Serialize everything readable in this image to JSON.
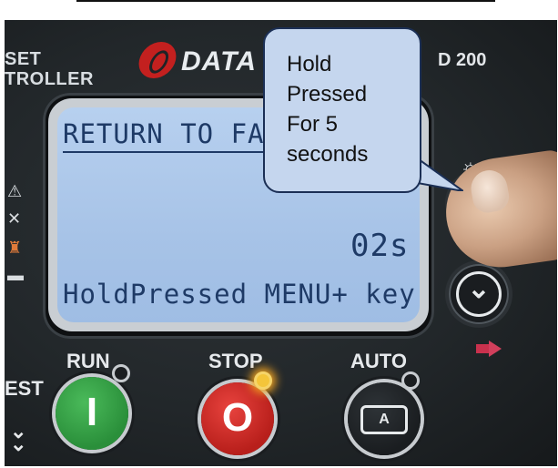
{
  "panel": {
    "left_legend": [
      "SET",
      "TROLLER"
    ],
    "brand": "DATA",
    "model": "D 200"
  },
  "lcd": {
    "line1": "RETURN TO FA",
    "countdown": "02s",
    "line3": "HoldPressed MENU+ key"
  },
  "callout": {
    "lines": [
      "Hold",
      "Pressed",
      "For 5",
      "seconds"
    ]
  },
  "buttons": {
    "run_label": "RUN",
    "stop_label": "STOP",
    "auto_label": "AUTO",
    "test_label": "EST",
    "run_glyph": "I",
    "stop_glyph": "O",
    "auto_glyph": "A"
  },
  "icons": {
    "warning": "warning-icon",
    "tools": "wrench-icon",
    "generator": "tower-icon",
    "battery": "battery-icon",
    "light": "light-icon",
    "down": "chevron-down-icon",
    "mute": "mute-horn-icon"
  },
  "colors": {
    "lcd": "#a9c5e8",
    "run": "#2e9a3f",
    "stop": "#c4231f",
    "callout": "#c5d6ee",
    "led": "#f4c53a"
  }
}
